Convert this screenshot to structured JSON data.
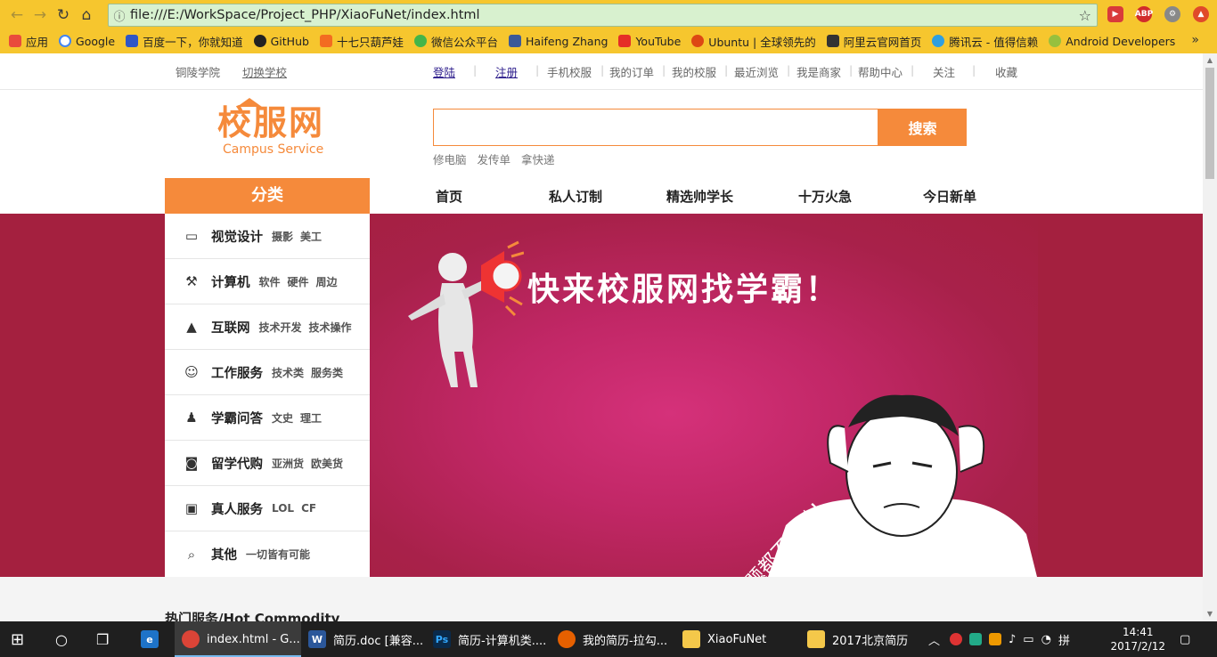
{
  "browser": {
    "url": "file:///E:/WorkSpace/Project_PHP/XiaoFuNet/index.html",
    "bookmarks": [
      "应用",
      "Google",
      "百度一下，你就知道",
      "GitHub",
      "十七只葫芦娃",
      "微信公众平台",
      "Haifeng Zhang",
      "YouTube",
      "Ubuntu | 全球领先的",
      "阿里云官网首页",
      "腾讯云 - 值得信赖",
      "Android Developers"
    ],
    "bookmark_more": "»",
    "abp_label": "ABP"
  },
  "topbar": {
    "school": "铜陵学院",
    "switch_school": "切换学校",
    "login": "登陆",
    "register": "注册",
    "links": [
      "手机校服",
      "我的订单",
      "我的校服",
      "最近浏览",
      "我是商家",
      "帮助中心",
      "关注",
      "收藏"
    ]
  },
  "logo": {
    "cn": "校服网",
    "en": "Campus Service"
  },
  "search": {
    "button": "搜索",
    "hot_words": [
      "修电脑",
      "发传单",
      "拿快递"
    ]
  },
  "category_title": "分类",
  "main_nav": [
    "首页",
    "私人订制",
    "精选帅学长",
    "十万火急",
    "今日新单"
  ],
  "categories": [
    {
      "name": "视觉设计",
      "subs": [
        "摄影",
        "美工"
      ]
    },
    {
      "name": "计算机",
      "subs": [
        "软件",
        "硬件",
        "周边"
      ]
    },
    {
      "name": "互联网",
      "subs": [
        "技术开发",
        "技术操作"
      ]
    },
    {
      "name": "工作服务",
      "subs": [
        "技术类",
        "服务类"
      ]
    },
    {
      "name": "学霸问答",
      "subs": [
        "文史",
        "理工"
      ]
    },
    {
      "name": "留学代购",
      "subs": [
        "亚洲货",
        "欧美货"
      ]
    },
    {
      "name": "真人服务",
      "subs": [
        "LOL",
        "CF"
      ]
    },
    {
      "name": "其他",
      "subs": [
        "一切皆有可能"
      ]
    }
  ],
  "banner": {
    "slogan": "快来校服网找学霸！",
    "stamp": "TM一题都不会做！"
  },
  "hot_section_title": "热门服务/Hot Commodity",
  "taskbar": {
    "items": [
      "index.html - G...",
      "简历.doc [兼容...",
      "简历-计算机类....",
      "我的简历-拉勾...",
      "XiaoFuNet",
      "2017北京简历"
    ],
    "time": "14:41",
    "date": "2017/2/12"
  },
  "colors": {
    "accent": "#f58a3b",
    "banner": "#a4203f",
    "chrome": "#f6c62e"
  }
}
